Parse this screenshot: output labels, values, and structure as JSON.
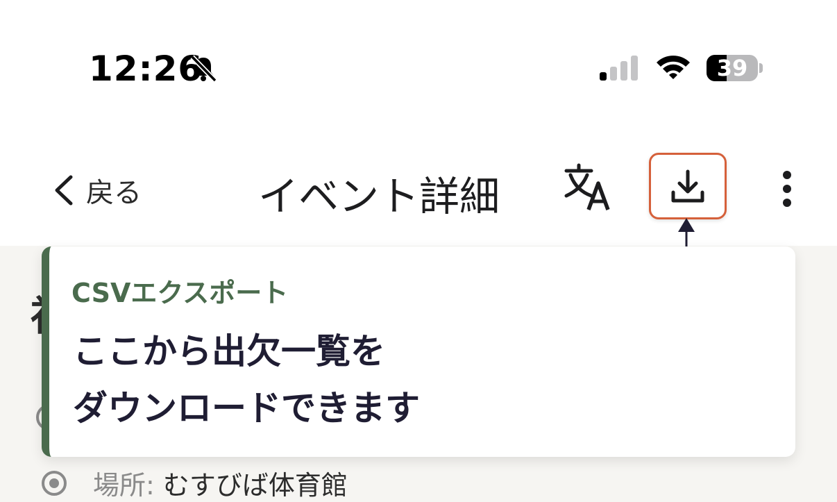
{
  "status_bar": {
    "time": "12:26",
    "battery_percent": "39",
    "battery_level": 0.39,
    "signal_bars_active": 1,
    "signal_bars_total": 4,
    "icons": [
      "bell-slash-icon",
      "cellular-signal-icon",
      "wifi-icon",
      "battery-icon"
    ]
  },
  "nav": {
    "back_label": "戻る",
    "title": "イベント詳細",
    "actions": [
      "translate-icon",
      "download-icon",
      "more-vertical-icon"
    ]
  },
  "tooltip": {
    "title": "CSVエクスポート",
    "line1": "ここから出欠一覧を",
    "line2": "ダウンロードできます"
  },
  "background": {
    "partial_char": "社",
    "venue_label": "場所:",
    "venue_value": "むすびば体育館"
  },
  "colors": {
    "accent_green": "#4a6b4d",
    "highlight_orange": "#d5603a",
    "tooltip_text": "#1f1d33"
  }
}
